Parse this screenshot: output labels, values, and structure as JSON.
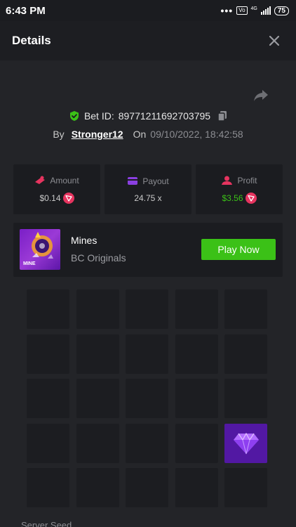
{
  "status_bar": {
    "time": "6:43 PM",
    "dots": "•••",
    "volte": "Vo LTE",
    "network": "4G",
    "battery": "75"
  },
  "header": {
    "title": "Details",
    "close_icon": "close-icon"
  },
  "bet": {
    "id_label": "Bet ID:",
    "id_value": "89771211692703795",
    "by_label": "By",
    "username": "Stronger12",
    "on_label": "On",
    "datetime": "09/10/2022, 18:42:58"
  },
  "stats": [
    {
      "label": "Amount",
      "value": "$0.14",
      "icon": "amount-icon",
      "currency_icon": "tron-icon"
    },
    {
      "label": "Payout",
      "value": "24.75 x",
      "icon": "payout-icon"
    },
    {
      "label": "Profit",
      "value": "$3.56",
      "icon": "profit-icon",
      "currency_icon": "tron-icon"
    }
  ],
  "game": {
    "name": "Mines",
    "provider": "BC Originals",
    "thumb_text": "MINE",
    "play_label": "Play Now"
  },
  "grid": {
    "rows": 5,
    "cols": 5,
    "revealed_gem": {
      "row": 3,
      "col": 4
    }
  },
  "server_seed": {
    "label": "Server Seed"
  },
  "colors": {
    "background": "#232428",
    "card": "#1b1c20",
    "tile": "#1c1d21",
    "accent_green": "#3bc117",
    "gem_tile": "#5218a3",
    "tron_red": "#e6345f"
  }
}
